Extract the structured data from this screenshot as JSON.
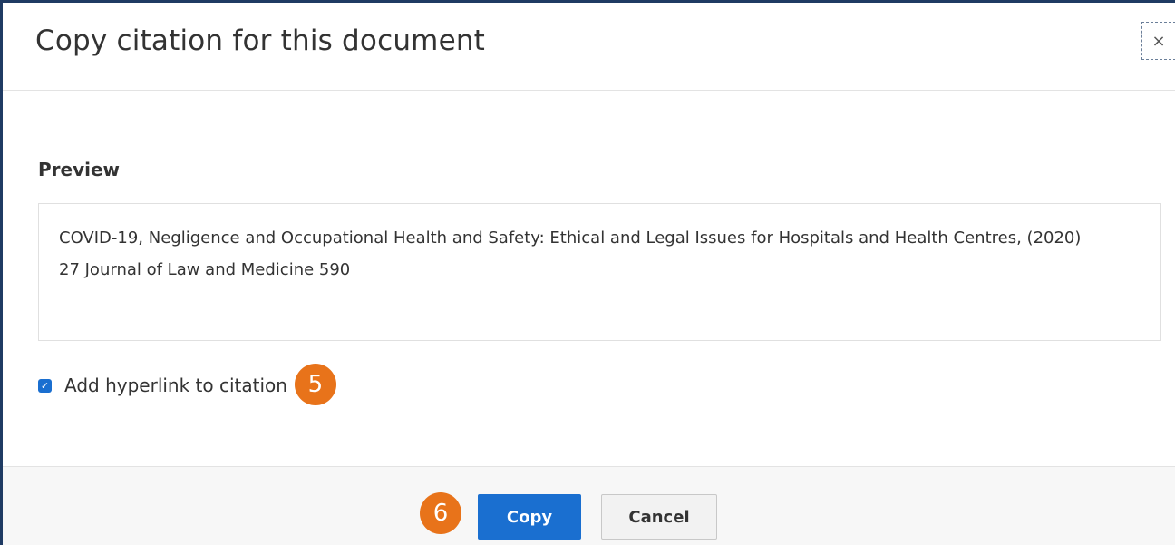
{
  "dialog": {
    "title": "Copy citation for this document",
    "close_label": "×"
  },
  "preview": {
    "heading": "Preview",
    "citation": "COVID-19, Negligence and Occupational Health and Safety: Ethical and Legal Issues for Hospitals and Health Centres, (2020) 27 Journal of Law and Medicine 590"
  },
  "options": {
    "hyperlink_label": "Add hyperlink to citation",
    "hyperlink_checked": true,
    "check_mark": "✓"
  },
  "badges": {
    "step5": "5",
    "step6": "6",
    "color": "#e8731a"
  },
  "footer": {
    "copy_label": "Copy",
    "cancel_label": "Cancel"
  },
  "colors": {
    "primary": "#1a6fd0",
    "border_accent": "#1f3b63"
  }
}
